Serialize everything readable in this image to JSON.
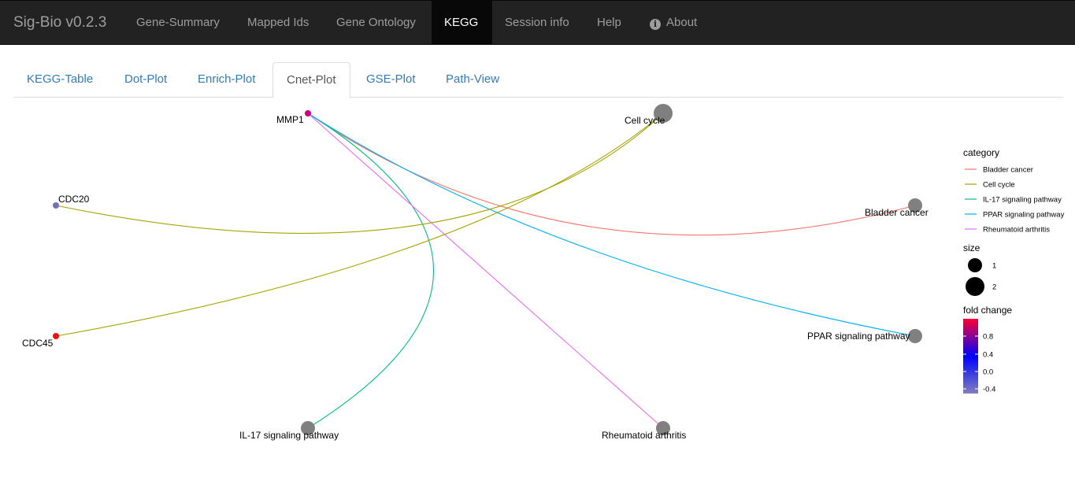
{
  "navbar": {
    "brand": "Sig-Bio v0.2.3",
    "items": [
      {
        "label": "Gene-Summary",
        "active": false
      },
      {
        "label": "Mapped Ids",
        "active": false
      },
      {
        "label": "Gene Ontology",
        "active": false
      },
      {
        "label": "KEGG",
        "active": true
      },
      {
        "label": "Session info",
        "active": false
      },
      {
        "label": "Help",
        "active": false
      },
      {
        "label": "About",
        "active": false,
        "icon": "info-icon"
      }
    ]
  },
  "tabs": [
    {
      "label": "KEGG-Table",
      "active": false
    },
    {
      "label": "Dot-Plot",
      "active": false
    },
    {
      "label": "Enrich-Plot",
      "active": false
    },
    {
      "label": "Cnet-Plot",
      "active": true
    },
    {
      "label": "GSE-Plot",
      "active": false
    },
    {
      "label": "Path-View",
      "active": false
    }
  ],
  "chart_data": {
    "type": "network",
    "genes": [
      {
        "name": "MMP1",
        "color": "#cc0077"
      },
      {
        "name": "CDC20",
        "color": "#7570b3"
      },
      {
        "name": "CDC45",
        "color": "#ee1111"
      }
    ],
    "categories": [
      {
        "name": "Cell cycle",
        "size": 2
      },
      {
        "name": "Bladder cancer",
        "size": 1
      },
      {
        "name": "PPAR signaling pathway",
        "size": 1
      },
      {
        "name": "IL-17 signaling pathway",
        "size": 1
      },
      {
        "name": "Rheumatoid arthritis",
        "size": 1
      }
    ],
    "edges": [
      {
        "gene": "MMP1",
        "category": "Bladder cancer"
      },
      {
        "gene": "MMP1",
        "category": "IL-17 signaling pathway"
      },
      {
        "gene": "MMP1",
        "category": "PPAR signaling pathway"
      },
      {
        "gene": "MMP1",
        "category": "Rheumatoid arthritis"
      },
      {
        "gene": "CDC20",
        "category": "Cell cycle"
      },
      {
        "gene": "CDC45",
        "category": "Cell cycle"
      }
    ],
    "legend": {
      "category_title": "category",
      "category_items": [
        {
          "label": "Bladder cancer",
          "color": "#f8766d"
        },
        {
          "label": "Cell cycle",
          "color": "#a3a500"
        },
        {
          "label": "IL-17 signaling pathway",
          "color": "#00bf7d"
        },
        {
          "label": "PPAR signaling pathway",
          "color": "#00b0f6"
        },
        {
          "label": "Rheumatoid arthritis",
          "color": "#e76bf3"
        }
      ],
      "size_title": "size",
      "size_items": [
        1,
        2
      ],
      "fold_title": "fold change",
      "fold_ticks": [
        "0.8",
        "0.4",
        "0.0",
        "-0.4"
      ],
      "fold_gradient": [
        "#ff0033",
        "#0000ff",
        "#8080c0"
      ]
    },
    "category_node_color": "#808080"
  }
}
